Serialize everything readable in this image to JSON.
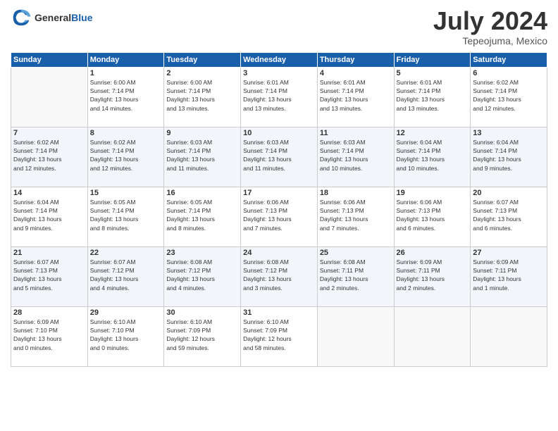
{
  "logo": {
    "general": "General",
    "blue": "Blue"
  },
  "title": "July 2024",
  "subtitle": "Tepeojuma, Mexico",
  "days_of_week": [
    "Sunday",
    "Monday",
    "Tuesday",
    "Wednesday",
    "Thursday",
    "Friday",
    "Saturday"
  ],
  "weeks": [
    [
      {
        "day": "",
        "info": ""
      },
      {
        "day": "1",
        "info": "Sunrise: 6:00 AM\nSunset: 7:14 PM\nDaylight: 13 hours\nand 14 minutes."
      },
      {
        "day": "2",
        "info": "Sunrise: 6:00 AM\nSunset: 7:14 PM\nDaylight: 13 hours\nand 13 minutes."
      },
      {
        "day": "3",
        "info": "Sunrise: 6:01 AM\nSunset: 7:14 PM\nDaylight: 13 hours\nand 13 minutes."
      },
      {
        "day": "4",
        "info": "Sunrise: 6:01 AM\nSunset: 7:14 PM\nDaylight: 13 hours\nand 13 minutes."
      },
      {
        "day": "5",
        "info": "Sunrise: 6:01 AM\nSunset: 7:14 PM\nDaylight: 13 hours\nand 13 minutes."
      },
      {
        "day": "6",
        "info": "Sunrise: 6:02 AM\nSunset: 7:14 PM\nDaylight: 13 hours\nand 12 minutes."
      }
    ],
    [
      {
        "day": "7",
        "info": "Sunrise: 6:02 AM\nSunset: 7:14 PM\nDaylight: 13 hours\nand 12 minutes."
      },
      {
        "day": "8",
        "info": "Sunrise: 6:02 AM\nSunset: 7:14 PM\nDaylight: 13 hours\nand 12 minutes."
      },
      {
        "day": "9",
        "info": "Sunrise: 6:03 AM\nSunset: 7:14 PM\nDaylight: 13 hours\nand 11 minutes."
      },
      {
        "day": "10",
        "info": "Sunrise: 6:03 AM\nSunset: 7:14 PM\nDaylight: 13 hours\nand 11 minutes."
      },
      {
        "day": "11",
        "info": "Sunrise: 6:03 AM\nSunset: 7:14 PM\nDaylight: 13 hours\nand 10 minutes."
      },
      {
        "day": "12",
        "info": "Sunrise: 6:04 AM\nSunset: 7:14 PM\nDaylight: 13 hours\nand 10 minutes."
      },
      {
        "day": "13",
        "info": "Sunrise: 6:04 AM\nSunset: 7:14 PM\nDaylight: 13 hours\nand 9 minutes."
      }
    ],
    [
      {
        "day": "14",
        "info": "Sunrise: 6:04 AM\nSunset: 7:14 PM\nDaylight: 13 hours\nand 9 minutes."
      },
      {
        "day": "15",
        "info": "Sunrise: 6:05 AM\nSunset: 7:14 PM\nDaylight: 13 hours\nand 8 minutes."
      },
      {
        "day": "16",
        "info": "Sunrise: 6:05 AM\nSunset: 7:14 PM\nDaylight: 13 hours\nand 8 minutes."
      },
      {
        "day": "17",
        "info": "Sunrise: 6:06 AM\nSunset: 7:13 PM\nDaylight: 13 hours\nand 7 minutes."
      },
      {
        "day": "18",
        "info": "Sunrise: 6:06 AM\nSunset: 7:13 PM\nDaylight: 13 hours\nand 7 minutes."
      },
      {
        "day": "19",
        "info": "Sunrise: 6:06 AM\nSunset: 7:13 PM\nDaylight: 13 hours\nand 6 minutes."
      },
      {
        "day": "20",
        "info": "Sunrise: 6:07 AM\nSunset: 7:13 PM\nDaylight: 13 hours\nand 6 minutes."
      }
    ],
    [
      {
        "day": "21",
        "info": "Sunrise: 6:07 AM\nSunset: 7:13 PM\nDaylight: 13 hours\nand 5 minutes."
      },
      {
        "day": "22",
        "info": "Sunrise: 6:07 AM\nSunset: 7:12 PM\nDaylight: 13 hours\nand 4 minutes."
      },
      {
        "day": "23",
        "info": "Sunrise: 6:08 AM\nSunset: 7:12 PM\nDaylight: 13 hours\nand 4 minutes."
      },
      {
        "day": "24",
        "info": "Sunrise: 6:08 AM\nSunset: 7:12 PM\nDaylight: 13 hours\nand 3 minutes."
      },
      {
        "day": "25",
        "info": "Sunrise: 6:08 AM\nSunset: 7:11 PM\nDaylight: 13 hours\nand 2 minutes."
      },
      {
        "day": "26",
        "info": "Sunrise: 6:09 AM\nSunset: 7:11 PM\nDaylight: 13 hours\nand 2 minutes."
      },
      {
        "day": "27",
        "info": "Sunrise: 6:09 AM\nSunset: 7:11 PM\nDaylight: 13 hours\nand 1 minute."
      }
    ],
    [
      {
        "day": "28",
        "info": "Sunrise: 6:09 AM\nSunset: 7:10 PM\nDaylight: 13 hours\nand 0 minutes."
      },
      {
        "day": "29",
        "info": "Sunrise: 6:10 AM\nSunset: 7:10 PM\nDaylight: 13 hours\nand 0 minutes."
      },
      {
        "day": "30",
        "info": "Sunrise: 6:10 AM\nSunset: 7:09 PM\nDaylight: 12 hours\nand 59 minutes."
      },
      {
        "day": "31",
        "info": "Sunrise: 6:10 AM\nSunset: 7:09 PM\nDaylight: 12 hours\nand 58 minutes."
      },
      {
        "day": "",
        "info": ""
      },
      {
        "day": "",
        "info": ""
      },
      {
        "day": "",
        "info": ""
      }
    ]
  ]
}
